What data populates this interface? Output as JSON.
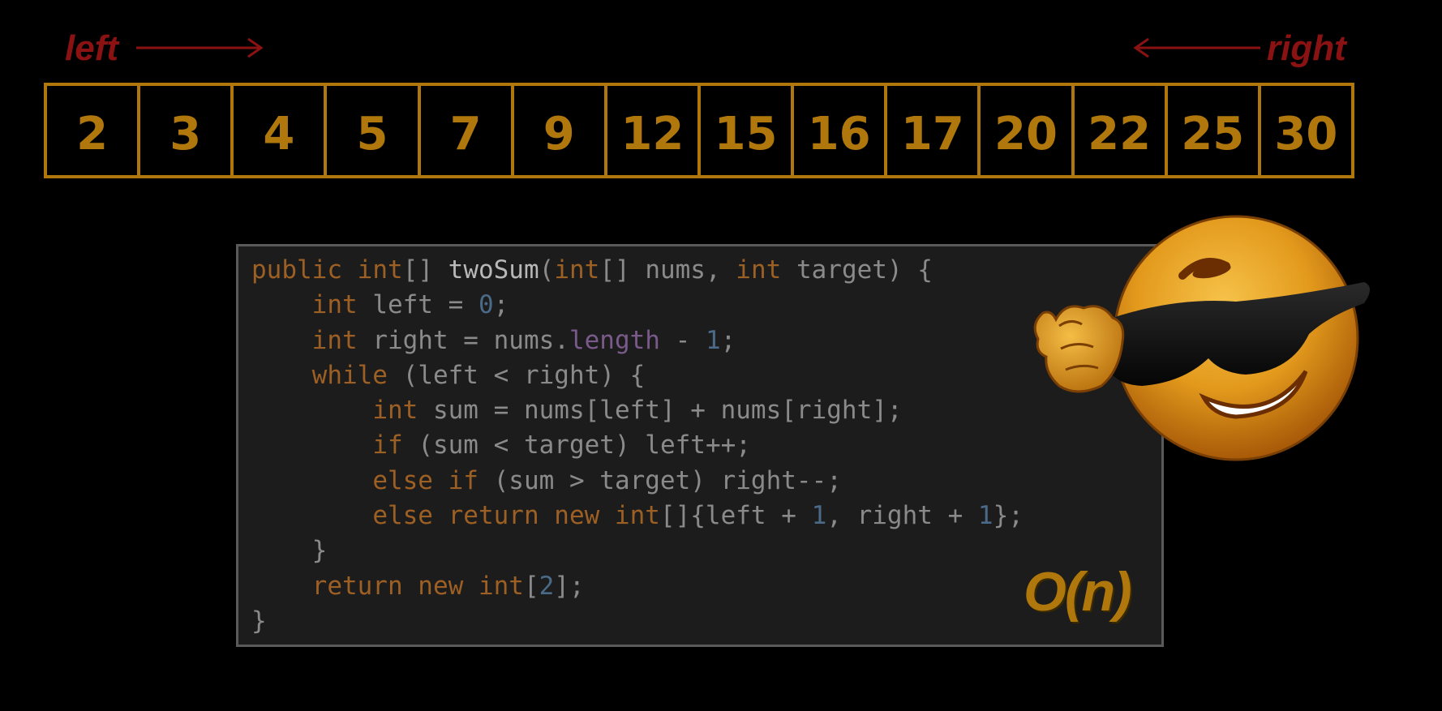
{
  "pointers": {
    "left_label": "left",
    "right_label": "right",
    "arrow_color": "#8a1212"
  },
  "array": {
    "values": [
      "2",
      "3",
      "4",
      "5",
      "7",
      "9",
      "12",
      "15",
      "16",
      "17",
      "20",
      "22",
      "25",
      "30"
    ],
    "color": "#b0780c"
  },
  "code": {
    "lines": [
      [
        [
          "kw",
          "public "
        ],
        [
          "kw",
          "int"
        ],
        [
          "plain",
          "[] "
        ],
        [
          "fn",
          "twoSum"
        ],
        [
          "plain",
          "("
        ],
        [
          "kw",
          "int"
        ],
        [
          "plain",
          "[] "
        ],
        [
          "ident",
          "nums"
        ],
        [
          "plain",
          ", "
        ],
        [
          "kw",
          "int "
        ],
        [
          "ident",
          "target"
        ],
        [
          "plain",
          ") {"
        ]
      ],
      [
        [
          "plain",
          "    "
        ],
        [
          "kw",
          "int "
        ],
        [
          "ident",
          "left "
        ],
        [
          "plain",
          "= "
        ],
        [
          "num",
          "0"
        ],
        [
          "plain",
          ";"
        ]
      ],
      [
        [
          "plain",
          "    "
        ],
        [
          "kw",
          "int "
        ],
        [
          "ident",
          "right "
        ],
        [
          "plain",
          "= "
        ],
        [
          "ident",
          "nums"
        ],
        [
          "plain",
          "."
        ],
        [
          "prop",
          "length"
        ],
        [
          "plain",
          " - "
        ],
        [
          "num",
          "1"
        ],
        [
          "plain",
          ";"
        ]
      ],
      [
        [
          "plain",
          "    "
        ],
        [
          "kw",
          "while "
        ],
        [
          "plain",
          "("
        ],
        [
          "ident",
          "left "
        ],
        [
          "plain",
          "< "
        ],
        [
          "ident",
          "right"
        ],
        [
          "plain",
          ") {"
        ]
      ],
      [
        [
          "plain",
          "        "
        ],
        [
          "kw",
          "int "
        ],
        [
          "ident",
          "sum "
        ],
        [
          "plain",
          "= "
        ],
        [
          "ident",
          "nums"
        ],
        [
          "plain",
          "["
        ],
        [
          "ident",
          "left"
        ],
        [
          "plain",
          "] + "
        ],
        [
          "ident",
          "nums"
        ],
        [
          "plain",
          "["
        ],
        [
          "ident",
          "right"
        ],
        [
          "plain",
          "];"
        ]
      ],
      [
        [
          "plain",
          "        "
        ],
        [
          "kw",
          "if "
        ],
        [
          "plain",
          "("
        ],
        [
          "ident",
          "sum "
        ],
        [
          "plain",
          "< "
        ],
        [
          "ident",
          "target"
        ],
        [
          "plain",
          ") "
        ],
        [
          "ident",
          "left"
        ],
        [
          "plain",
          "++;"
        ]
      ],
      [
        [
          "plain",
          "        "
        ],
        [
          "kw",
          "else if "
        ],
        [
          "plain",
          "("
        ],
        [
          "ident",
          "sum "
        ],
        [
          "plain",
          "> "
        ],
        [
          "ident",
          "target"
        ],
        [
          "plain",
          ") "
        ],
        [
          "ident",
          "right"
        ],
        [
          "plain",
          "--;"
        ]
      ],
      [
        [
          "plain",
          "        "
        ],
        [
          "kw",
          "else return new int"
        ],
        [
          "plain",
          "[]{"
        ],
        [
          "ident",
          "left "
        ],
        [
          "plain",
          "+ "
        ],
        [
          "num",
          "1"
        ],
        [
          "plain",
          ", "
        ],
        [
          "ident",
          "right "
        ],
        [
          "plain",
          "+ "
        ],
        [
          "num",
          "1"
        ],
        [
          "plain",
          "};"
        ]
      ],
      [
        [
          "plain",
          "    }"
        ]
      ],
      [
        [
          "plain",
          "    "
        ],
        [
          "kw",
          "return new int"
        ],
        [
          "plain",
          "["
        ],
        [
          "num",
          "2"
        ],
        [
          "plain",
          "];"
        ]
      ],
      [
        [
          "plain",
          "}"
        ]
      ]
    ]
  },
  "complexity_label": "O(n)",
  "emoji_icon": "cool-sunglasses-emoji-icon"
}
